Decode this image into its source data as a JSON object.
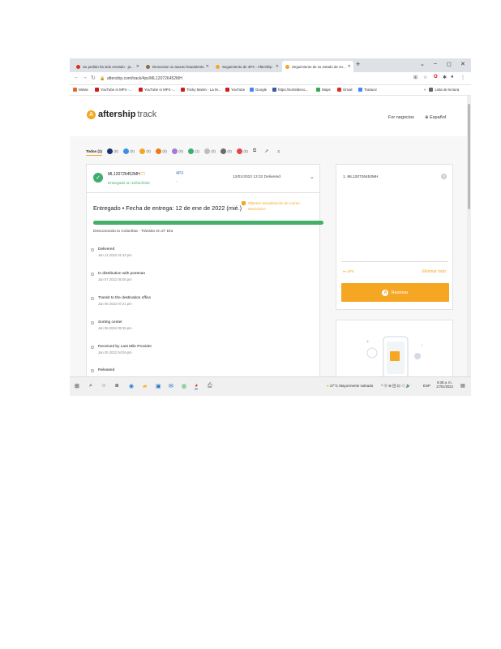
{
  "browser": {
    "tabs": [
      {
        "title": "Su pedido ha sido enviado - ja...",
        "icon": "gmail-icon",
        "color": "#d93025",
        "active": false
      },
      {
        "title": "Denunciar un asunto fraudulento",
        "icon": "paypal-icon",
        "color": "#8a6d3b",
        "active": false
      },
      {
        "title": "Seguimiento de 4PX - AfterShip",
        "icon": "aftership-icon",
        "color": "#f5a623",
        "active": false
      },
      {
        "title": "Seguimiento de su estado de en...",
        "icon": "aftership-icon",
        "color": "#f5a623",
        "active": true
      }
    ],
    "new_tab": "+",
    "window_controls": [
      "⌄",
      "–",
      "◻",
      "✕"
    ],
    "url": "aftership.com/track/4px/ML120726452MH",
    "bookmarks": [
      {
        "label": "Melas",
        "color": "#e06a2c"
      },
      {
        "label": "YouTube in MP4 -...",
        "color": "#cc1d1d"
      },
      {
        "label": "YouTube in MP4 -...",
        "color": "#cc1d1d"
      },
      {
        "label": "Tricky Martin - La M...",
        "color": "#cc1d1d"
      },
      {
        "label": "YouTube",
        "color": "#cc1d1d"
      },
      {
        "label": "Google",
        "color": "#4285f4"
      },
      {
        "label": "https://sorteldeco...",
        "color": "#3b5998"
      },
      {
        "label": "Maps",
        "color": "#34a853"
      },
      {
        "label": "Gmail",
        "color": "#d93025"
      },
      {
        "label": "Traducir",
        "color": "#4285f4"
      }
    ],
    "reading_list": "Lista de lectura"
  },
  "header": {
    "logo_word1": "aftership",
    "logo_word2": "track",
    "business_link": "For negocios",
    "language": "Español"
  },
  "filters": [
    {
      "label": "Todos (1)",
      "color": "",
      "all": true
    },
    {
      "label": "(0)",
      "color": "#1e2f6b"
    },
    {
      "label": "(0)",
      "color": "#3d8fe0"
    },
    {
      "label": "(0)",
      "color": "#f5a623"
    },
    {
      "label": "(0)",
      "color": "#f07a18"
    },
    {
      "label": "(0)",
      "color": "#a37ad8"
    },
    {
      "label": "(1)",
      "color": "#3dae6e"
    },
    {
      "label": "(0)",
      "color": "#bdbdbd"
    },
    {
      "label": "(0)",
      "color": "#6b6b6b"
    },
    {
      "label": "(0)",
      "color": "#e04747"
    }
  ],
  "shipment": {
    "tracking": "ML120726452MH",
    "status": "Entregado en 12/01/2022",
    "carrier": "4PX",
    "carrier_sub": "-",
    "last_update": "12/01/2022 13:32 Delivered"
  },
  "detail": {
    "headline": "Entregado • Fecha de entrega: 12 de ene de 2022 (mié.)",
    "email_update": "Obtener actualización de correo electrónico",
    "progress_pct": 100,
    "route": "Desconocido to Colombia - Tránsito en 27 Día",
    "events": [
      {
        "title": "Delivered",
        "time": "Jan 12 2022 01:32 pm"
      },
      {
        "title": "In distribution with postman",
        "time": "Jan 07 2022 05:05 pm"
      },
      {
        "title": "Transit to the destination office",
        "time": "Jan 05 2022 07:21 pm"
      },
      {
        "title": "Sorting center",
        "time": "Jan 05 2022 05:35 pm"
      },
      {
        "title": "Received by Last Mile Provider",
        "time": "Jan 05 2022 04:09 pm"
      },
      {
        "title": "Released",
        "time": ""
      }
    ]
  },
  "right_panel": {
    "entry": "1. ML120726452MH",
    "courier": "4PX",
    "clear_all": "Eliminar todo",
    "track_button": "Rastrear"
  },
  "taskbar": {
    "weather": "27°C  Mayormente soleado",
    "lang": "ESP",
    "time": "8:38 a. m.",
    "date": "17/01/2022"
  }
}
